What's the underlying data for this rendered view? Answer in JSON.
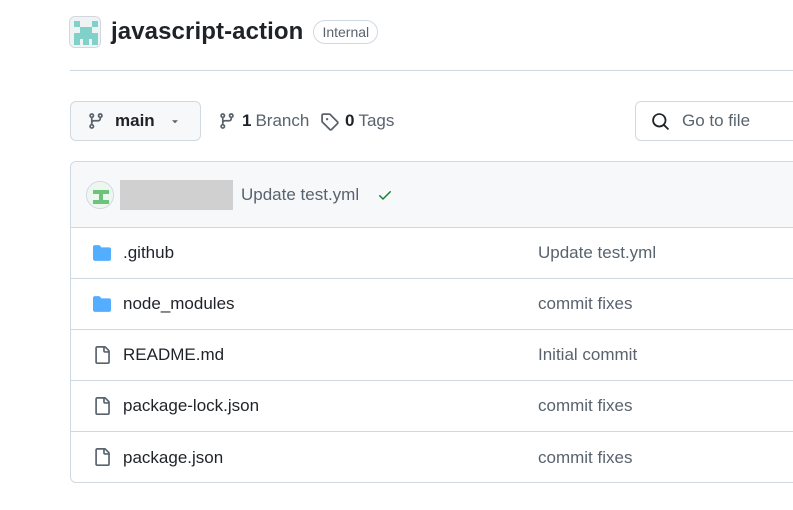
{
  "repo": {
    "name": "javascript-action",
    "visibility": "Internal",
    "avatar_icon": "repo-identicon",
    "avatar_color": "#7fd1c9"
  },
  "toolbar": {
    "branch": "main",
    "branch_count": "1",
    "branch_label": "Branch",
    "tag_count": "0",
    "tag_label": "Tags",
    "goto_placeholder": "Go to file"
  },
  "latest_commit": {
    "author": "",
    "message": "Update test.yml",
    "status": "success",
    "status_color": "#1a7f37"
  },
  "files": [
    {
      "name": ".github",
      "type": "folder",
      "icon": "folder-icon",
      "commit": "Update test.yml"
    },
    {
      "name": "node_modules",
      "type": "folder",
      "icon": "folder-icon",
      "commit": "commit fixes"
    },
    {
      "name": "README.md",
      "type": "file",
      "icon": "file-icon",
      "commit": "Initial commit"
    },
    {
      "name": "package-lock.json",
      "type": "file",
      "icon": "file-icon",
      "commit": "commit fixes"
    },
    {
      "name": "package.json",
      "type": "file",
      "icon": "file-icon",
      "commit": "commit fixes"
    }
  ],
  "colors": {
    "folder": "#54aeff",
    "file_icon": "#59636e",
    "border": "#d1d9e0",
    "header_bg": "#f6f8fa"
  }
}
